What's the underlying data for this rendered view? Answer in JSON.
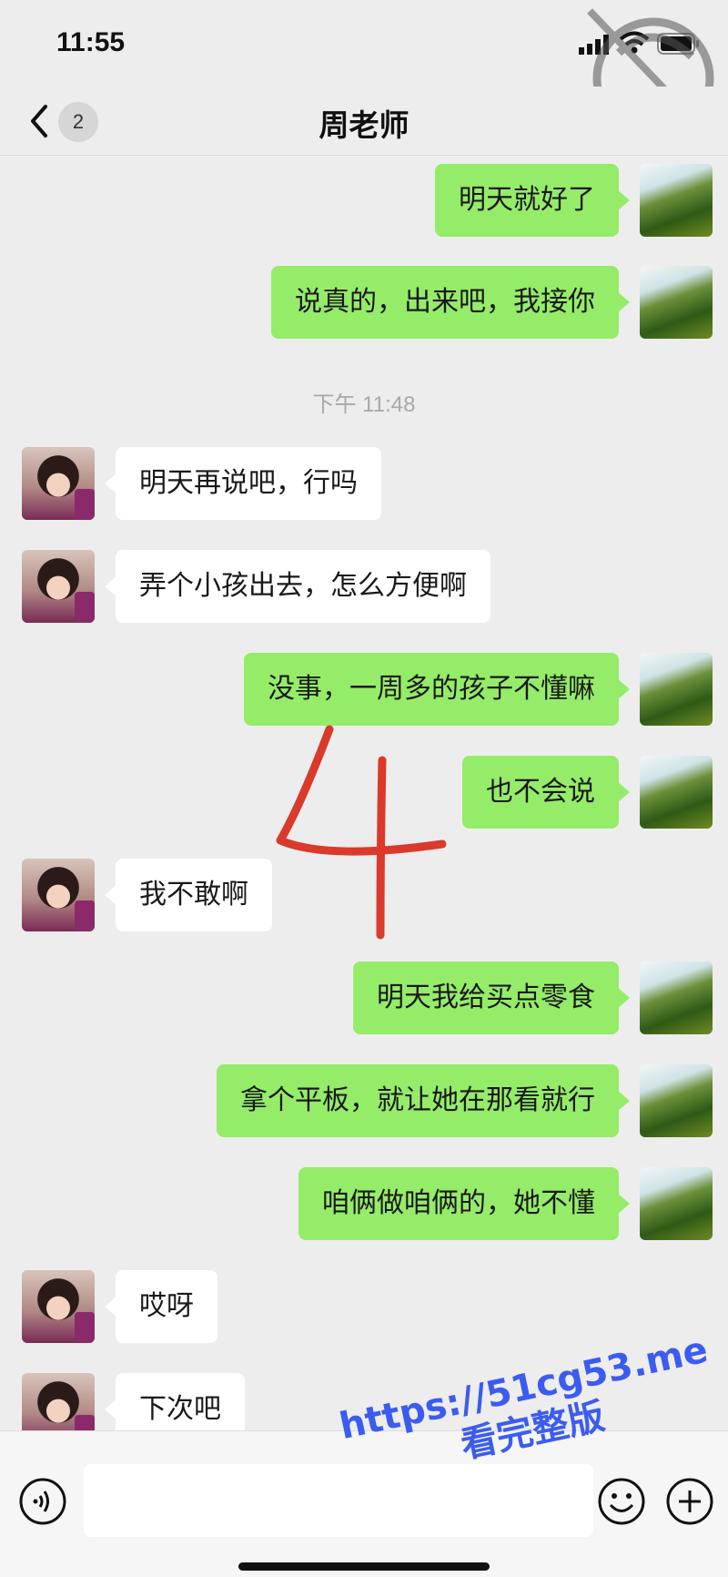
{
  "status_bar": {
    "time": "11:55"
  },
  "nav": {
    "unread_count": "2",
    "title": "周老师"
  },
  "messages": [
    {
      "side": "right",
      "text": "明天就好了"
    },
    {
      "side": "right",
      "text": "说真的，出来吧，我接你"
    },
    {
      "timestamp": "下午 11:48"
    },
    {
      "side": "left",
      "text": "明天再说吧，行吗"
    },
    {
      "side": "left",
      "text": "弄个小孩出去，怎么方便啊"
    },
    {
      "side": "right",
      "text": "没事，一周多的孩子不懂嘛"
    },
    {
      "side": "right",
      "text": "也不会说"
    },
    {
      "side": "left",
      "text": "我不敢啊"
    },
    {
      "side": "right",
      "text": "明天我给买点零食"
    },
    {
      "side": "right",
      "text": "拿个平板，就让她在那看就行"
    },
    {
      "side": "right",
      "text": "咱俩做咱俩的，她不懂"
    },
    {
      "side": "left",
      "text": "哎呀"
    },
    {
      "side": "left",
      "text": "下次吧"
    }
  ],
  "annotation": {
    "text": "4"
  },
  "input_bar": {
    "placeholder": ""
  },
  "overlay": {
    "line1": "https://51cg53.me",
    "line2": "看完整版"
  },
  "colors": {
    "outgoing_bubble": "#95ec69",
    "incoming_bubble": "#ffffff",
    "background": "#ededed",
    "annotation_red": "#d93a2b",
    "overlay_blue": "#3c5cf0"
  },
  "icons": [
    "signal-icon",
    "wifi-icon",
    "battery-icon",
    "back-icon",
    "voice-icon",
    "emoji-icon",
    "plus-icon"
  ]
}
